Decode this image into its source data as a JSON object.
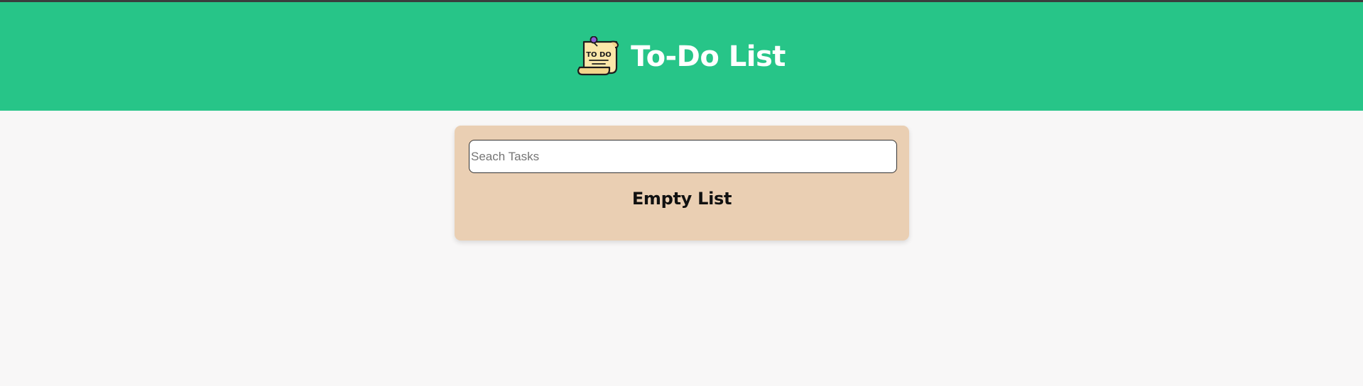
{
  "header": {
    "title": "To-Do List",
    "logo_icon": "todo-note-icon",
    "logo_text": "TO DO",
    "background_color": "#27c588"
  },
  "main": {
    "search": {
      "placeholder": "Seach Tasks",
      "value": ""
    },
    "empty_message": "Empty List",
    "card_color": "#eacfb3"
  }
}
